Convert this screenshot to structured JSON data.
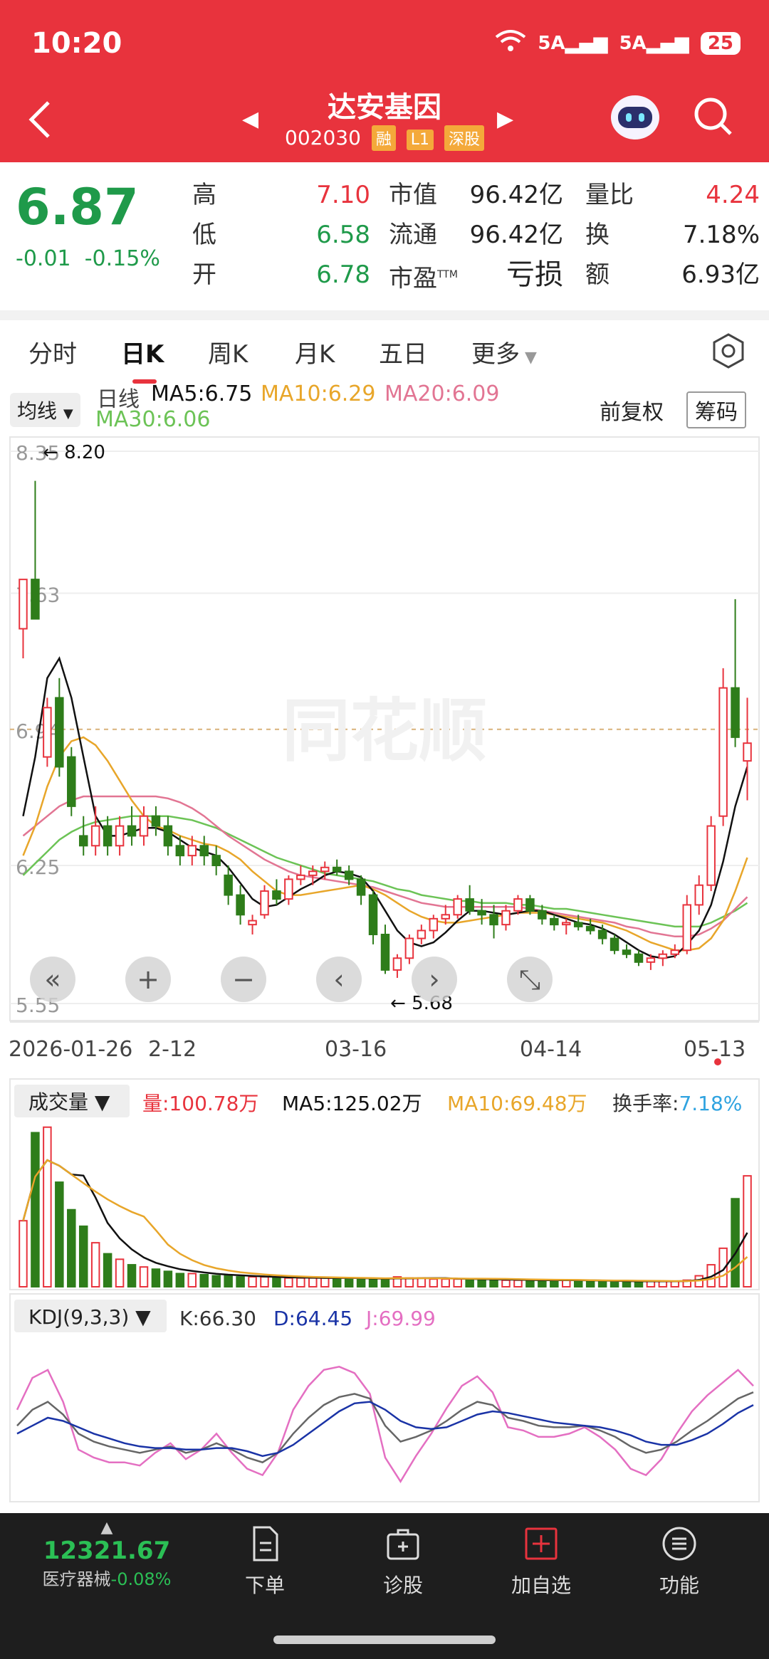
{
  "status_bar": {
    "time": "10:20",
    "network1": "5A",
    "network2": "5A",
    "battery": "25"
  },
  "header": {
    "stock_name": "达安基因",
    "stock_code": "002030",
    "tags": [
      "融",
      "L1",
      "深股"
    ]
  },
  "quote": {
    "price": "6.87",
    "change": "-0.01",
    "change_pct": "-0.15%",
    "high_label": "高",
    "high": "7.10",
    "low_label": "低",
    "low": "6.58",
    "open_label": "开",
    "open": "6.78",
    "mktcap_label": "市值",
    "mktcap": "96.42亿",
    "float_label": "流通",
    "float": "96.42亿",
    "pe_label": "市盈",
    "pe_sup": "TTM",
    "pe": "亏损",
    "vr_label": "量比",
    "vr": "4.24",
    "turnover_label": "换",
    "turnover": "7.18%",
    "amount_label": "额",
    "amount": "6.93亿"
  },
  "tabs": [
    "分时",
    "日K",
    "周K",
    "月K",
    "五日",
    "更多"
  ],
  "active_tab": 1,
  "ma_bar": {
    "selector": "均线",
    "period": "日线",
    "ma5": "MA5:6.75",
    "ma10": "MA10:6.29",
    "ma20": "MA20:6.09",
    "ma30": "MA30:6.06",
    "fq": "前复权",
    "chip": "筹码"
  },
  "colors": {
    "up": "#e8333d",
    "down": "#2e7d1a",
    "ma5": "#111111",
    "ma10": "#e8a62a",
    "ma20": "#e27593",
    "ma30": "#6cc356"
  },
  "chart_data": [
    {
      "type": "candlestick",
      "y_ticks": [
        "8.35",
        "7.63",
        "6.94",
        "6.25",
        "5.55"
      ],
      "ylim": [
        5.55,
        8.35
      ],
      "x_labels": [
        "2026-01-26",
        "2-12",
        "03-16",
        "04-14",
        "05-13"
      ],
      "annotations": [
        "8.20",
        "5.68"
      ],
      "watermark": "同花顺",
      "candles_ohlc": [
        [
          7.45,
          7.7,
          7.3,
          7.7
        ],
        [
          7.7,
          8.2,
          7.55,
          7.5
        ],
        [
          6.8,
          7.1,
          6.75,
          7.05
        ],
        [
          7.1,
          7.2,
          6.7,
          6.75
        ],
        [
          6.8,
          6.85,
          6.5,
          6.55
        ],
        [
          6.4,
          6.5,
          6.3,
          6.35
        ],
        [
          6.35,
          6.55,
          6.3,
          6.45
        ],
        [
          6.45,
          6.5,
          6.3,
          6.35
        ],
        [
          6.35,
          6.5,
          6.3,
          6.45
        ],
        [
          6.45,
          6.55,
          6.35,
          6.4
        ],
        [
          6.4,
          6.55,
          6.35,
          6.5
        ],
        [
          6.5,
          6.55,
          6.4,
          6.45
        ],
        [
          6.45,
          6.5,
          6.3,
          6.35
        ],
        [
          6.35,
          6.4,
          6.25,
          6.3
        ],
        [
          6.3,
          6.4,
          6.25,
          6.35
        ],
        [
          6.35,
          6.4,
          6.25,
          6.3
        ],
        [
          6.3,
          6.35,
          6.2,
          6.25
        ],
        [
          6.2,
          6.25,
          6.05,
          6.1
        ],
        [
          6.1,
          6.15,
          5.95,
          6.0
        ],
        [
          5.95,
          6.0,
          5.9,
          5.97
        ],
        [
          6.0,
          6.15,
          5.98,
          6.12
        ],
        [
          6.12,
          6.18,
          6.05,
          6.08
        ],
        [
          6.08,
          6.2,
          6.05,
          6.18
        ],
        [
          6.18,
          6.25,
          6.15,
          6.2
        ],
        [
          6.2,
          6.25,
          6.15,
          6.22
        ],
        [
          6.22,
          6.27,
          6.18,
          6.24
        ],
        [
          6.24,
          6.28,
          6.2,
          6.22
        ],
        [
          6.22,
          6.25,
          6.15,
          6.18
        ],
        [
          6.18,
          6.2,
          6.05,
          6.1
        ],
        [
          6.1,
          6.12,
          5.85,
          5.9
        ],
        [
          5.9,
          5.95,
          5.7,
          5.72
        ],
        [
          5.72,
          5.8,
          5.68,
          5.78
        ],
        [
          5.78,
          5.9,
          5.75,
          5.88
        ],
        [
          5.88,
          5.95,
          5.85,
          5.92
        ],
        [
          5.92,
          6.0,
          5.88,
          5.98
        ],
        [
          5.98,
          6.05,
          5.95,
          6.0
        ],
        [
          6.0,
          6.1,
          5.98,
          6.08
        ],
        [
          6.08,
          6.15,
          6.0,
          6.02
        ],
        [
          6.02,
          6.08,
          5.95,
          6.0
        ],
        [
          6.0,
          6.05,
          5.88,
          5.95
        ],
        [
          5.95,
          6.05,
          5.92,
          6.02
        ],
        [
          6.02,
          6.1,
          6.0,
          6.08
        ],
        [
          6.08,
          6.1,
          6.0,
          6.02
        ],
        [
          6.02,
          6.05,
          5.95,
          5.98
        ],
        [
          5.98,
          6.0,
          5.92,
          5.95
        ],
        [
          5.95,
          5.98,
          5.9,
          5.96
        ],
        [
          5.96,
          6.0,
          5.92,
          5.94
        ],
        [
          5.94,
          5.98,
          5.9,
          5.92
        ],
        [
          5.92,
          5.95,
          5.85,
          5.88
        ],
        [
          5.88,
          5.9,
          5.8,
          5.82
        ],
        [
          5.82,
          5.85,
          5.78,
          5.8
        ],
        [
          5.8,
          5.82,
          5.74,
          5.76
        ],
        [
          5.76,
          5.8,
          5.72,
          5.78
        ],
        [
          5.78,
          5.82,
          5.74,
          5.8
        ],
        [
          5.8,
          5.85,
          5.78,
          5.82
        ],
        [
          5.82,
          6.1,
          5.8,
          6.05
        ],
        [
          6.05,
          6.2,
          6.0,
          6.15
        ],
        [
          6.15,
          6.5,
          6.12,
          6.45
        ],
        [
          6.5,
          7.25,
          6.45,
          7.15
        ],
        [
          7.15,
          7.6,
          6.85,
          6.9
        ],
        [
          6.78,
          7.1,
          6.58,
          6.87
        ]
      ],
      "ma5": [
        6.5,
        6.8,
        7.2,
        7.3,
        7.1,
        6.8,
        6.5,
        6.4,
        6.4,
        6.42,
        6.44,
        6.44,
        6.42,
        6.38,
        6.34,
        6.32,
        6.3,
        6.24,
        6.16,
        6.08,
        6.04,
        6.05,
        6.09,
        6.13,
        6.16,
        6.2,
        6.22,
        6.21,
        6.19,
        6.12,
        6.02,
        5.92,
        5.86,
        5.84,
        5.86,
        5.91,
        5.97,
        6.02,
        6.02,
        6.01,
        6.0,
        6.01,
        6.02,
        6.02,
        6.0,
        5.98,
        5.96,
        5.95,
        5.93,
        5.9,
        5.86,
        5.82,
        5.79,
        5.78,
        5.79,
        5.85,
        5.92,
        6.05,
        6.27,
        6.55,
        6.75
      ],
      "ma10": [
        6.3,
        6.45,
        6.65,
        6.8,
        6.88,
        6.9,
        6.86,
        6.78,
        6.68,
        6.58,
        6.5,
        6.45,
        6.43,
        6.4,
        6.38,
        6.36,
        6.35,
        6.32,
        6.28,
        6.22,
        6.17,
        6.12,
        6.1,
        6.1,
        6.11,
        6.12,
        6.13,
        6.14,
        6.15,
        6.13,
        6.1,
        6.06,
        6.02,
        5.99,
        5.97,
        5.96,
        5.96,
        5.97,
        5.98,
        5.99,
        6.0,
        6.01,
        6.01,
        6.01,
        6.0,
        5.99,
        5.98,
        5.97,
        5.96,
        5.94,
        5.92,
        5.89,
        5.86,
        5.84,
        5.82,
        5.82,
        5.83,
        5.88,
        5.97,
        6.12,
        6.29
      ],
      "ma20": [
        6.4,
        6.45,
        6.5,
        6.55,
        6.58,
        6.6,
        6.6,
        6.6,
        6.6,
        6.6,
        6.6,
        6.6,
        6.59,
        6.57,
        6.54,
        6.5,
        6.45,
        6.4,
        6.36,
        6.32,
        6.28,
        6.25,
        6.22,
        6.2,
        6.19,
        6.18,
        6.17,
        6.16,
        6.15,
        6.14,
        6.12,
        6.1,
        6.08,
        6.06,
        6.05,
        6.04,
        6.04,
        6.04,
        6.04,
        6.04,
        6.04,
        6.04,
        6.03,
        6.02,
        6.01,
        6.0,
        5.99,
        5.98,
        5.97,
        5.96,
        5.94,
        5.93,
        5.91,
        5.9,
        5.89,
        5.89,
        5.9,
        5.93,
        5.97,
        6.03,
        6.09
      ],
      "ma30": [
        6.2,
        6.26,
        6.32,
        6.38,
        6.42,
        6.45,
        6.47,
        6.48,
        6.49,
        6.5,
        6.5,
        6.5,
        6.5,
        6.49,
        6.48,
        6.46,
        6.44,
        6.41,
        6.38,
        6.35,
        6.32,
        6.29,
        6.27,
        6.25,
        6.23,
        6.21,
        6.2,
        6.19,
        6.18,
        6.17,
        6.15,
        6.13,
        6.12,
        6.1,
        6.09,
        6.08,
        6.07,
        6.07,
        6.06,
        6.06,
        6.06,
        6.05,
        6.05,
        6.04,
        6.03,
        6.03,
        6.02,
        6.01,
        6.0,
        5.99,
        5.98,
        5.97,
        5.96,
        5.95,
        5.94,
        5.94,
        5.94,
        5.96,
        5.99,
        6.02,
        6.06
      ]
    },
    {
      "type": "bar",
      "title": "成交量",
      "legend": {
        "vol": "量:100.78万",
        "ma5": "MA5:125.02万",
        "ma10": "MA10:69.48万",
        "turn_label": "换手率:",
        "turn": "7.18%"
      },
      "values": [
        60,
        140,
        145,
        95,
        70,
        55,
        40,
        30,
        25,
        20,
        18,
        16,
        14,
        12,
        12,
        11,
        10,
        10,
        9,
        9,
        9,
        8,
        8,
        8,
        8,
        8,
        8,
        8,
        7,
        7,
        7,
        9,
        8,
        8,
        7,
        7,
        7,
        7,
        7,
        6,
        6,
        6,
        6,
        6,
        6,
        6,
        6,
        5,
        5,
        5,
        5,
        5,
        5,
        5,
        5,
        6,
        10,
        20,
        35,
        80,
        100.78
      ],
      "ylim": [
        0,
        150
      ]
    },
    {
      "type": "line",
      "title": "KDJ(9,3,3)",
      "legend": {
        "k": "K:66.30",
        "d": "D:64.45",
        "j": "J:69.99"
      },
      "k": [
        45,
        55,
        60,
        52,
        40,
        35,
        32,
        30,
        28,
        30,
        32,
        28,
        30,
        34,
        30,
        25,
        22,
        28,
        40,
        50,
        58,
        63,
        65,
        62,
        45,
        35,
        38,
        42,
        48,
        55,
        60,
        58,
        50,
        48,
        45,
        44,
        44,
        45,
        42,
        38,
        32,
        28,
        30,
        35,
        42,
        48,
        55,
        62,
        66
      ],
      "d": [
        40,
        45,
        50,
        48,
        44,
        40,
        37,
        34,
        32,
        31,
        31,
        30,
        30,
        31,
        31,
        29,
        26,
        28,
        33,
        40,
        47,
        54,
        59,
        60,
        55,
        48,
        44,
        43,
        44,
        48,
        52,
        54,
        53,
        51,
        49,
        47,
        46,
        45,
        44,
        42,
        39,
        35,
        33,
        33,
        36,
        40,
        46,
        53,
        58
      ],
      "j": [
        55,
        75,
        80,
        60,
        30,
        25,
        22,
        22,
        20,
        28,
        34,
        24,
        30,
        40,
        28,
        18,
        14,
        28,
        55,
        70,
        80,
        82,
        78,
        65,
        25,
        10,
        26,
        40,
        56,
        70,
        76,
        66,
        44,
        42,
        38,
        38,
        40,
        44,
        38,
        30,
        18,
        14,
        24,
        40,
        54,
        64,
        72,
        80,
        70
      ],
      "ylim": [
        0,
        100
      ]
    }
  ],
  "chart_controls": [
    "«",
    "+",
    "−",
    "‹",
    "›",
    "⤡"
  ],
  "bottom_nav": {
    "index_value": "12321.67",
    "index_name": "医疗器械",
    "index_change": "-0.08%",
    "items": [
      "下单",
      "诊股",
      "加自选",
      "功能"
    ]
  }
}
